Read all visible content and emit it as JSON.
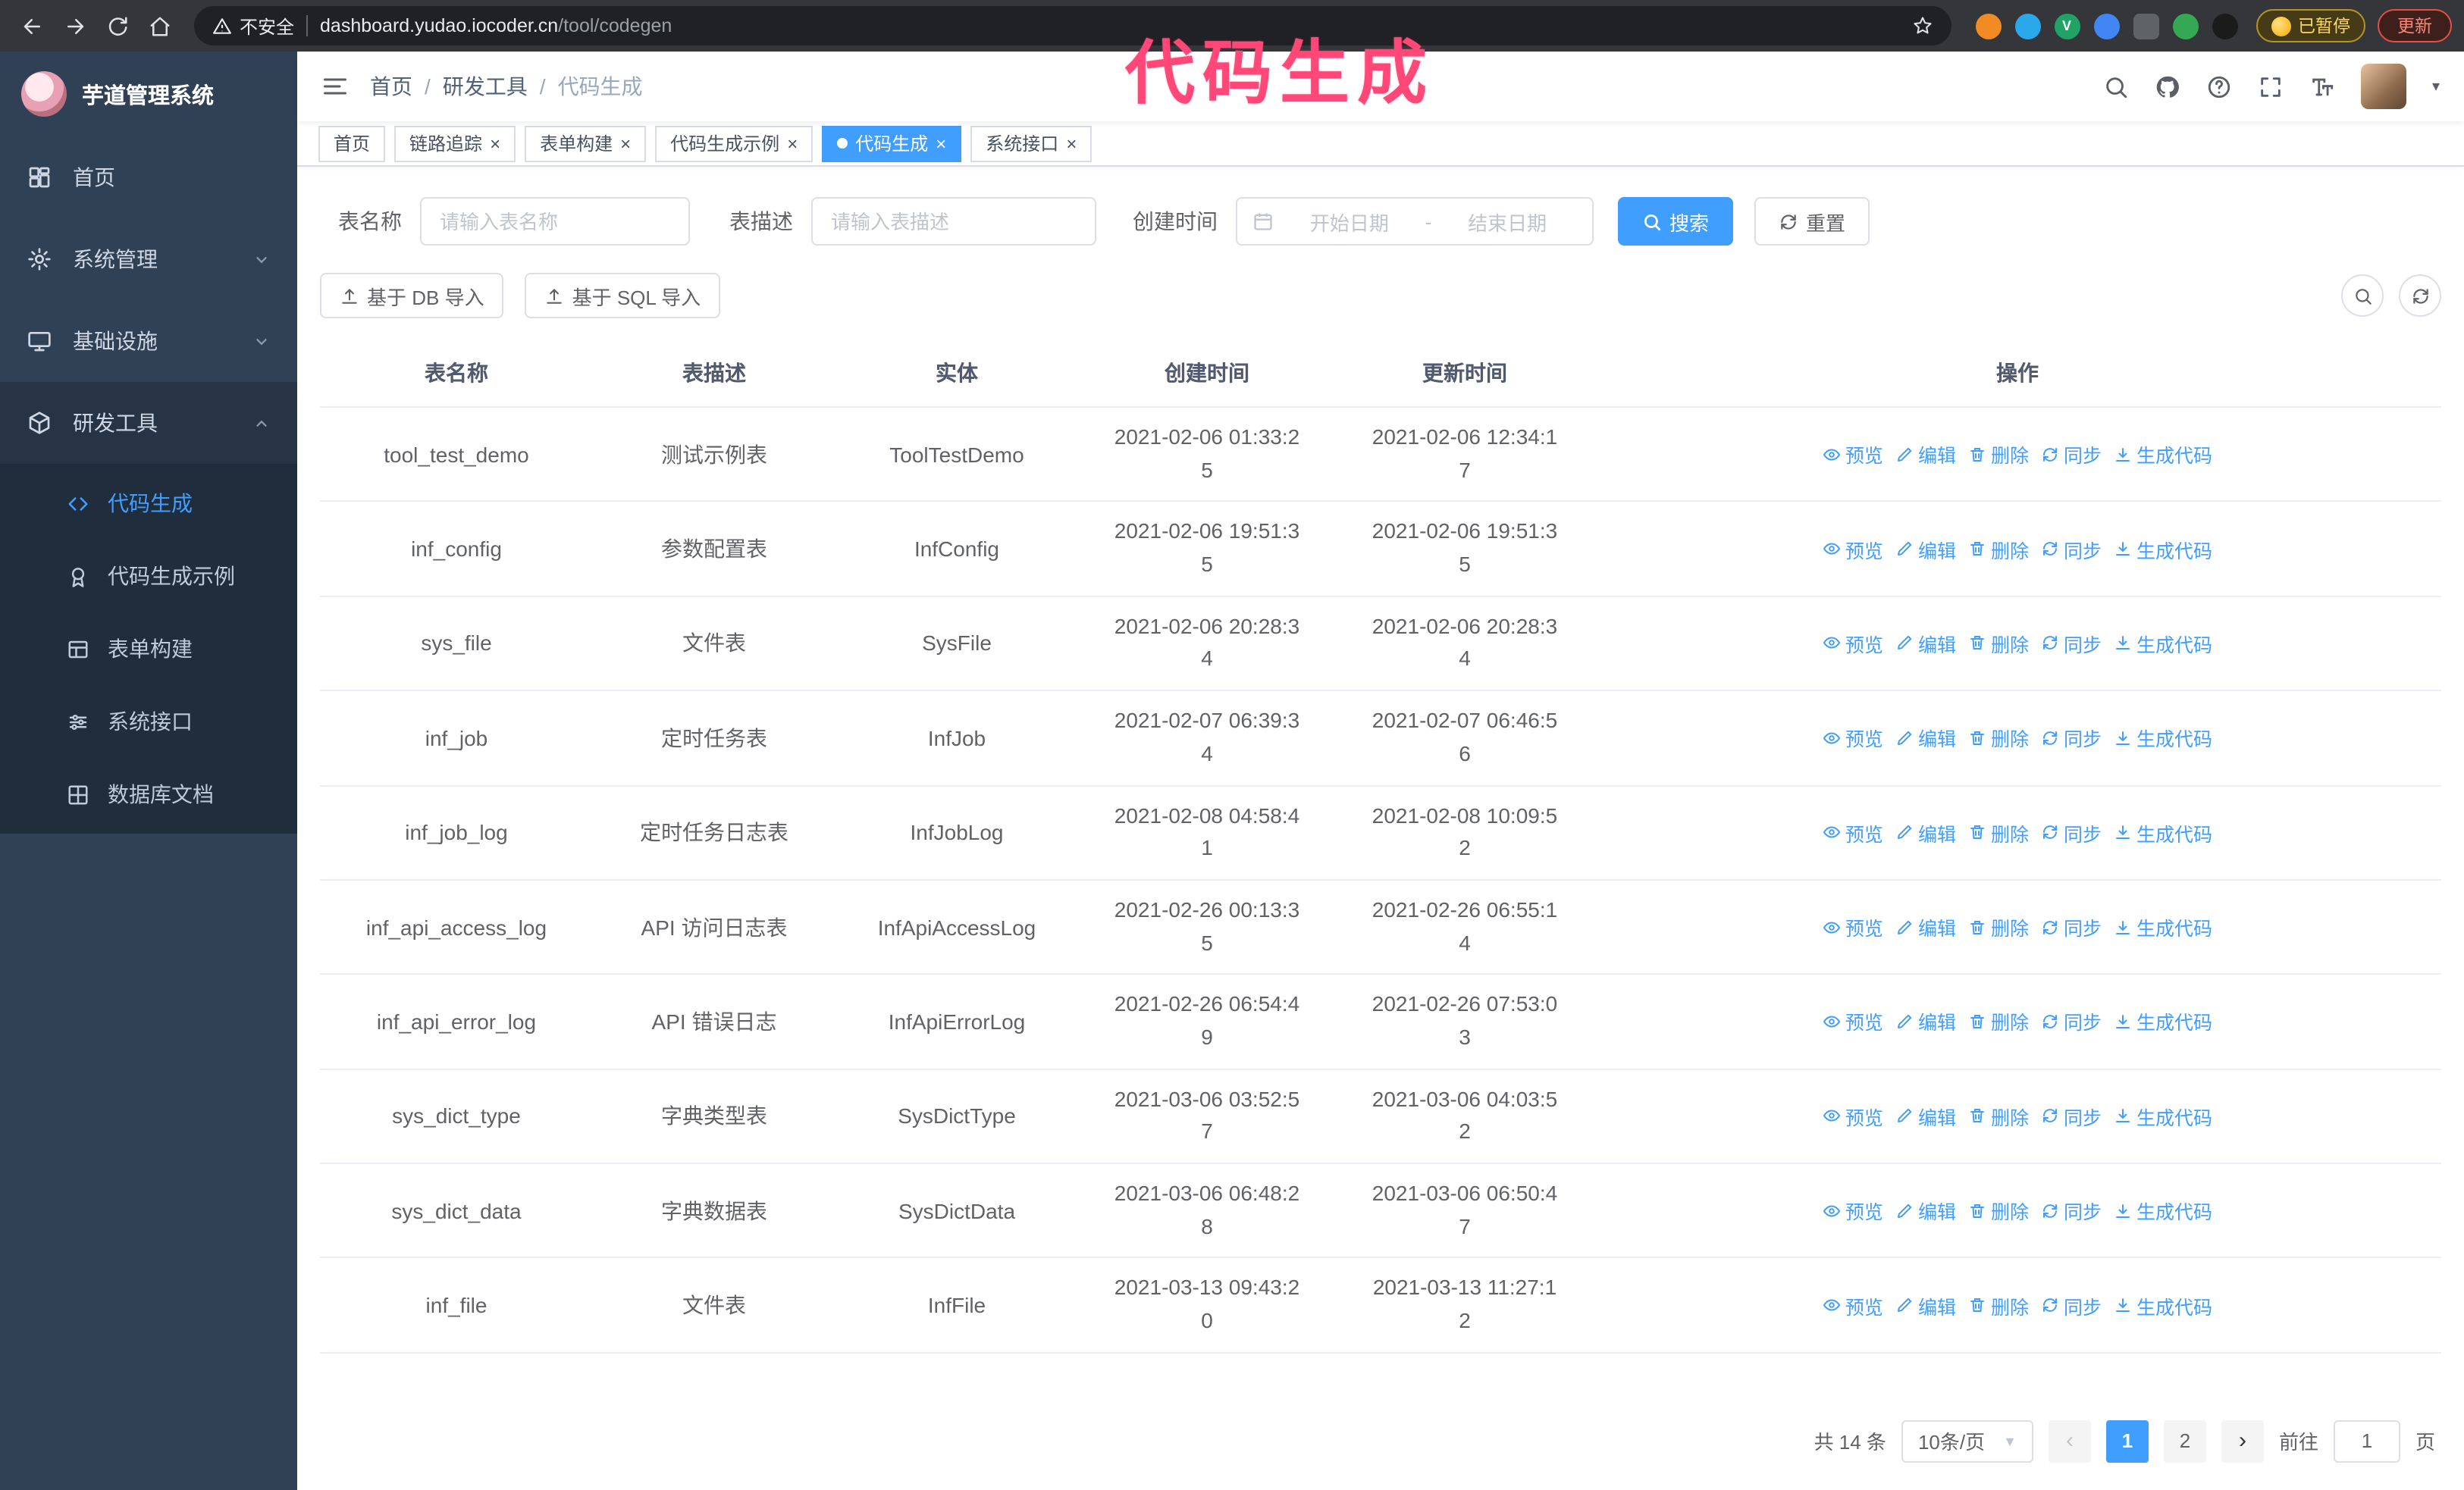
{
  "browser": {
    "security_warning": "不安全",
    "url_host": "dashboard.yudao.iocoder.cn",
    "url_path": "/tool/codegen",
    "paused_badge": "已暂停",
    "update_button": "更新"
  },
  "annotation": "代码生成",
  "colors": {
    "primary": "#409eff",
    "sidebar_bg": "#304156",
    "submenu_bg": "#1f2d3d",
    "annotation_pink": "#ff4778",
    "update_red": "#e25142",
    "paused_yellow": "#fdd663"
  },
  "sidebar": {
    "logo_title": "芋道管理系统",
    "items": [
      {
        "label": "首页",
        "icon": "dashboard-icon"
      },
      {
        "label": "系统管理",
        "icon": "gear-icon"
      },
      {
        "label": "基础设施",
        "icon": "monitor-icon"
      },
      {
        "label": "研发工具",
        "icon": "cube-icon"
      }
    ],
    "sub_items": [
      {
        "label": "代码生成",
        "icon": "code-icon",
        "active": true
      },
      {
        "label": "代码生成示例",
        "icon": "medal-icon"
      },
      {
        "label": "表单构建",
        "icon": "form-icon"
      },
      {
        "label": "系统接口",
        "icon": "sliders-icon"
      },
      {
        "label": "数据库文档",
        "icon": "grid-icon"
      }
    ]
  },
  "header": {
    "breadcrumb": [
      "首页",
      "研发工具",
      "代码生成"
    ],
    "right_icons": [
      "search-icon",
      "github-icon",
      "help-icon",
      "fullscreen-icon",
      "font-size-icon",
      "avatar"
    ]
  },
  "tabs": [
    {
      "label": "首页",
      "closable": false,
      "active": false
    },
    {
      "label": "链路追踪",
      "closable": true,
      "active": false
    },
    {
      "label": "表单构建",
      "closable": true,
      "active": false
    },
    {
      "label": "代码生成示例",
      "closable": true,
      "active": false
    },
    {
      "label": "代码生成",
      "closable": true,
      "active": true
    },
    {
      "label": "系统接口",
      "closable": true,
      "active": false
    }
  ],
  "filters": {
    "table_name_label": "表名称",
    "table_name_placeholder": "请输入表名称",
    "table_desc_label": "表描述",
    "table_desc_placeholder": "请输入表描述",
    "create_time_label": "创建时间",
    "date_start_placeholder": "开始日期",
    "date_separator": "-",
    "date_end_placeholder": "结束日期",
    "search_button": "搜索",
    "reset_button": "重置"
  },
  "toolbar": {
    "import_db_button": "基于 DB 导入",
    "import_sql_button": "基于 SQL 导入"
  },
  "table": {
    "columns": [
      "表名称",
      "表描述",
      "实体",
      "创建时间",
      "更新时间",
      "操作"
    ],
    "actions": [
      "预览",
      "编辑",
      "删除",
      "同步",
      "生成代码"
    ],
    "action_icons": [
      "eye-icon",
      "pencil-icon",
      "trash-icon",
      "sync-icon",
      "download-icon"
    ],
    "rows": [
      {
        "name": "tool_test_demo",
        "desc": "测试示例表",
        "entity": "ToolTestDemo",
        "created": "2021-02-06 01:33:25",
        "updated": "2021-02-06 12:34:17"
      },
      {
        "name": "inf_config",
        "desc": "参数配置表",
        "entity": "InfConfig",
        "created": "2021-02-06 19:51:35",
        "updated": "2021-02-06 19:51:35"
      },
      {
        "name": "sys_file",
        "desc": "文件表",
        "entity": "SysFile",
        "created": "2021-02-06 20:28:34",
        "updated": "2021-02-06 20:28:34"
      },
      {
        "name": "inf_job",
        "desc": "定时任务表",
        "entity": "InfJob",
        "created": "2021-02-07 06:39:34",
        "updated": "2021-02-07 06:46:56"
      },
      {
        "name": "inf_job_log",
        "desc": "定时任务日志表",
        "entity": "InfJobLog",
        "created": "2021-02-08 04:58:41",
        "updated": "2021-02-08 10:09:52"
      },
      {
        "name": "inf_api_access_log",
        "desc": "API 访问日志表",
        "entity": "InfApiAccessLog",
        "created": "2021-02-26 00:13:35",
        "updated": "2021-02-26 06:55:14"
      },
      {
        "name": "inf_api_error_log",
        "desc": "API 错误日志",
        "entity": "InfApiErrorLog",
        "created": "2021-02-26 06:54:49",
        "updated": "2021-02-26 07:53:03"
      },
      {
        "name": "sys_dict_type",
        "desc": "字典类型表",
        "entity": "SysDictType",
        "created": "2021-03-06 03:52:57",
        "updated": "2021-03-06 04:03:52"
      },
      {
        "name": "sys_dict_data",
        "desc": "字典数据表",
        "entity": "SysDictData",
        "created": "2021-03-06 06:48:28",
        "updated": "2021-03-06 06:50:47"
      },
      {
        "name": "inf_file",
        "desc": "文件表",
        "entity": "InfFile",
        "created": "2021-03-13 09:43:20",
        "updated": "2021-03-13 11:27:12"
      }
    ]
  },
  "pagination": {
    "total": "共 14 条",
    "page_size": "10条/页",
    "pages": [
      "1",
      "2"
    ],
    "active_page": "1",
    "prev_arrow": "‹",
    "next_arrow": "›",
    "goto_label": "前往",
    "goto_value": "1",
    "goto_suffix": "页"
  }
}
